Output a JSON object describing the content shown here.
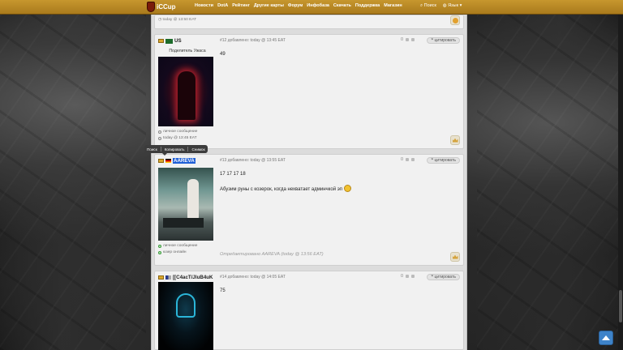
{
  "nav": {
    "logo": "iCCup",
    "links": [
      "Новости",
      "DotA",
      "Рейтинг",
      "Другие карты",
      "Форум",
      "Инфобаза",
      "Скачать",
      "Поддержка",
      "Магазин"
    ],
    "search": "Поиск",
    "lang": "Язык"
  },
  "prev_post": {
    "time": "today @ 13:50 EAT"
  },
  "posts": [
    {
      "author": "US",
      "user_title": "Поделитель Ужаса",
      "header": "#12 добавлено: today @ 13:45 EAT",
      "votes": "0",
      "quote": "цитировать",
      "body": "49",
      "links": [
        "личное сообщение",
        "today @ 13:45 EAT"
      ]
    },
    {
      "author": "AAREVA",
      "header": "#13 добавлено: today @ 13:55 EAT",
      "votes": "0",
      "quote": "цитировать",
      "body_line1": "17 17 17 18",
      "body_line2": "Абузим руны с козерок, когда нехватает админчкой эп",
      "edited": "Отредактировано AAREVA (today @ 13:56 EAT)",
      "links": [
        "личное сообщение",
        "юзер онлайн"
      ]
    },
    {
      "author": "[[C4acT/JluB4uK",
      "header": "#14 добавлено: today @ 14:05 EAT",
      "votes": "0",
      "quote": "цитировать",
      "body": "75"
    }
  ],
  "context_menu": [
    "Поиск",
    "Копировать",
    "Снимок"
  ]
}
